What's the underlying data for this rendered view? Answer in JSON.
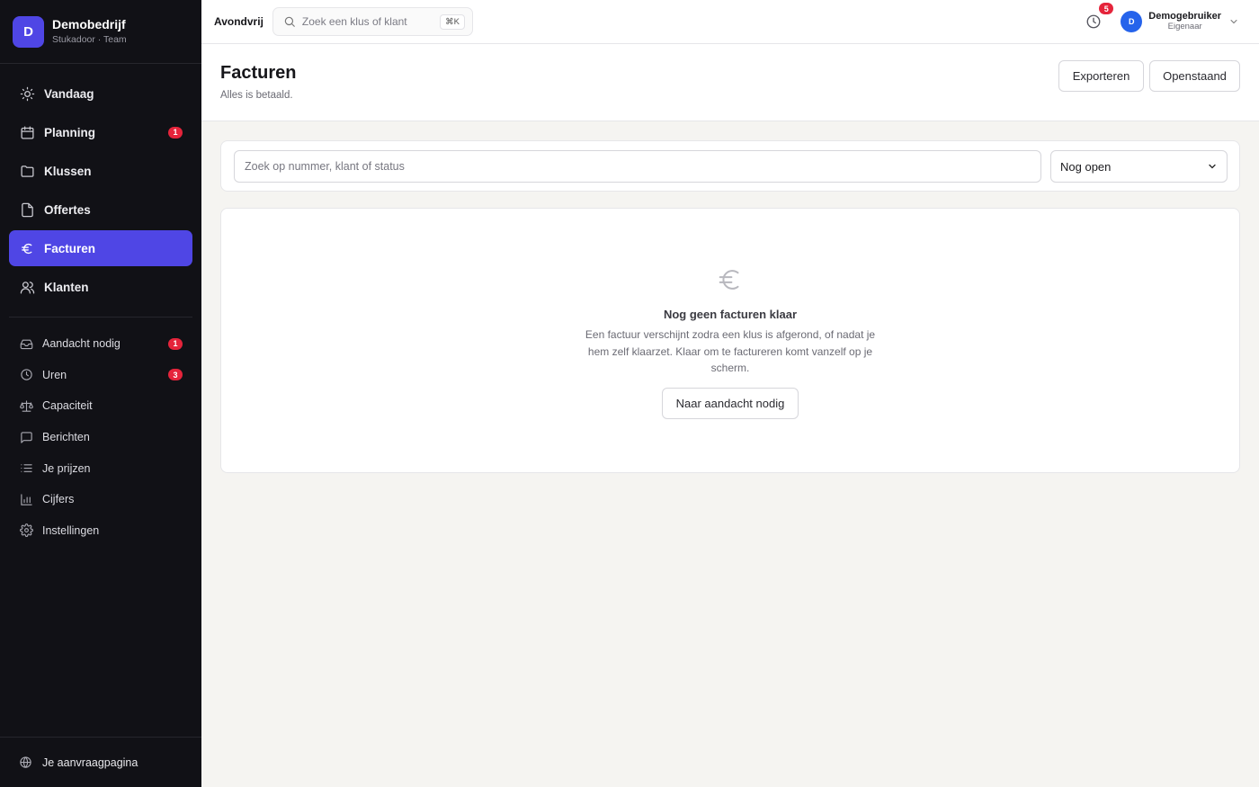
{
  "brand": {
    "avatar_letter": "D",
    "name": "Demobedrijf",
    "subtitle": "Stukadoor · Team"
  },
  "nav_primary": [
    {
      "label": "Vandaag",
      "icon": "sun-icon"
    },
    {
      "label": "Planning",
      "icon": "calendar-icon",
      "badge": "1"
    },
    {
      "label": "Klussen",
      "icon": "folder-icon"
    },
    {
      "label": "Offertes",
      "icon": "file-icon"
    },
    {
      "label": "Facturen",
      "icon": "euro-icon",
      "active": true
    },
    {
      "label": "Klanten",
      "icon": "users-icon"
    }
  ],
  "nav_secondary": [
    {
      "label": "Aandacht nodig",
      "icon": "inbox-icon",
      "badge": "1"
    },
    {
      "label": "Uren",
      "icon": "clock-icon",
      "badge": "3"
    },
    {
      "label": "Capaciteit",
      "icon": "scale-icon"
    },
    {
      "label": "Berichten",
      "icon": "message-icon"
    },
    {
      "label": "Je prijzen",
      "icon": "list-icon"
    },
    {
      "label": "Cijfers",
      "icon": "bar-chart-icon"
    },
    {
      "label": "Instellingen",
      "icon": "gear-icon"
    }
  ],
  "sidebar_footer": {
    "label": "Je aanvraagpagina",
    "icon": "globe-icon"
  },
  "topbar": {
    "app_name": "Avondvrij",
    "search_placeholder": "Zoek een klus of klant",
    "shortcut": "⌘K",
    "notification_count": "5",
    "user": {
      "avatar_letter": "D",
      "name": "Demogebruiker",
      "role": "Eigenaar"
    }
  },
  "header": {
    "title": "Facturen",
    "subtitle": "Alles is betaald.",
    "export_label": "Exporteren",
    "open_label": "Openstaand"
  },
  "filter": {
    "placeholder": "Zoek op nummer, klant of status",
    "status_value": "Nog open"
  },
  "empty_state": {
    "title": "Nog geen facturen klaar",
    "description": "Een factuur verschijnt zodra een klus is afgerond, of nadat je hem zelf klaarzet. Klaar om te factureren komt vanzelf op je scherm.",
    "button_label": "Naar aandacht nodig"
  },
  "colors": {
    "accent": "#4f46e5",
    "sidebar_bg": "#111116",
    "badge": "#e5243b",
    "avatar": "#2563eb"
  }
}
